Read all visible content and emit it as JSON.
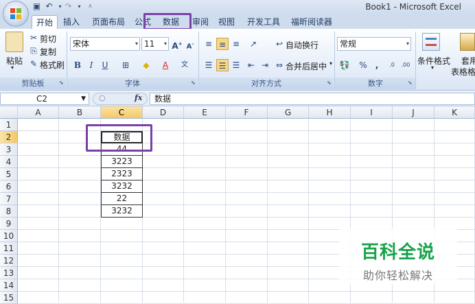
{
  "window": {
    "title": "Book1 - Microsoft Excel"
  },
  "quick_access": [
    "save-icon",
    "undo-icon",
    "redo-icon",
    "customize-icon"
  ],
  "tabs": [
    {
      "label": "开始",
      "active": true
    },
    {
      "label": "插入"
    },
    {
      "label": "页面布局"
    },
    {
      "label": "公式"
    },
    {
      "label": "数据",
      "highlighted": true
    },
    {
      "label": "审阅"
    },
    {
      "label": "视图"
    },
    {
      "label": "开发工具"
    },
    {
      "label": "福昕阅读器"
    }
  ],
  "ribbon": {
    "clipboard": {
      "paste": "粘贴",
      "cut": "剪切",
      "copy": "复制",
      "format_painter": "格式刷",
      "label": "剪贴板"
    },
    "font": {
      "name": "宋体",
      "size": "11",
      "bold": "B",
      "italic": "I",
      "underline": "U",
      "label": "字体"
    },
    "alignment": {
      "wrap": "自动换行",
      "merge": "合并后居中",
      "label": "对齐方式"
    },
    "number": {
      "format": "常规",
      "percent": "%",
      "comma": ",",
      "label": "数字"
    },
    "styles": {
      "conditional": "条件格式",
      "table_format": "套用",
      "table_format2": "表格格"
    }
  },
  "formula_bar": {
    "cell_ref": "C2",
    "fx": "fx",
    "content": "数据"
  },
  "columns": [
    "A",
    "B",
    "C",
    "D",
    "E",
    "F",
    "G",
    "H",
    "I",
    "J",
    "K"
  ],
  "rows": [
    "1",
    "2",
    "3",
    "4",
    "5",
    "6",
    "7",
    "8",
    "9",
    "10",
    "11",
    "12",
    "13",
    "14",
    "15"
  ],
  "cells": [
    {
      "ref": "C2",
      "value": "数据"
    },
    {
      "ref": "C3",
      "value": "44"
    },
    {
      "ref": "C4",
      "value": "3223"
    },
    {
      "ref": "C5",
      "value": "2323"
    },
    {
      "ref": "C6",
      "value": "3232"
    },
    {
      "ref": "C7",
      "value": "22"
    },
    {
      "ref": "C8",
      "value": "3232"
    }
  ],
  "watermark": {
    "title": "百科全说",
    "subtitle": "助你轻松解决"
  },
  "colors": {
    "highlight": "#7a3fa8",
    "selected_header": "#f6c866",
    "watermark_green": "#16a34a"
  }
}
